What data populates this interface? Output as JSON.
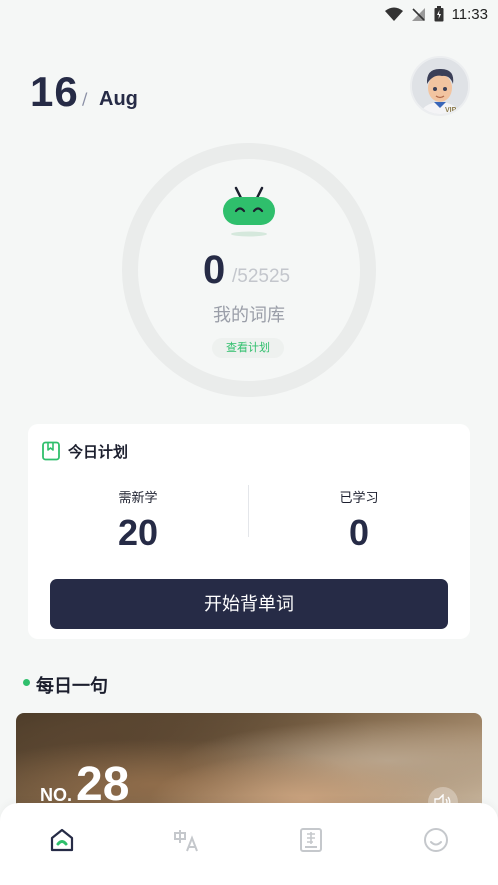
{
  "status_bar": {
    "time": "11:33",
    "icons": [
      "wifi-icon",
      "no-signal-icon",
      "battery-icon"
    ]
  },
  "header": {
    "day": "16",
    "separator": "/",
    "month": "Aug",
    "avatar_badge": "VIP"
  },
  "progress": {
    "learned": "0",
    "total": "/52525",
    "label": "我的词库",
    "view_plan_label": "查看计划"
  },
  "plan_card": {
    "title": "今日计划",
    "new_label": "需新学",
    "new_value": "20",
    "learned_label": "已学习",
    "learned_value": "0",
    "start_button": "开始背单词"
  },
  "daily": {
    "title": "每日一句",
    "no_prefix": "NO.",
    "no_value": "28"
  },
  "bottom_nav": {
    "items": [
      "home-icon",
      "translate-icon",
      "dictionary-icon",
      "profile-icon"
    ],
    "active_color": "#262b46",
    "accent_color": "#2fbf6c",
    "inactive_color": "#c5c8cc"
  },
  "colors": {
    "primary_dark": "#262b46",
    "accent_green": "#2fbf6c",
    "background": "#f5f7f6"
  }
}
